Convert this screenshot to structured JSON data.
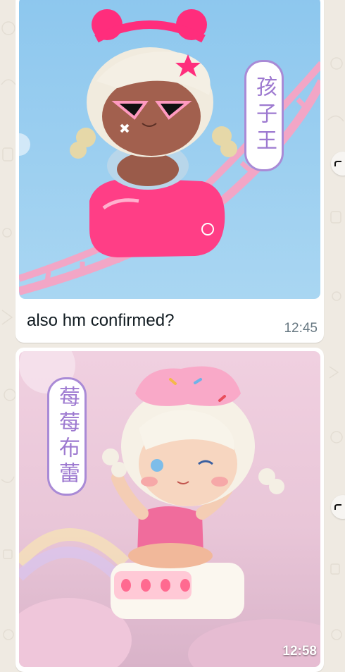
{
  "chat": {
    "messages": [
      {
        "type": "image",
        "image": {
          "label": "孩子王"
        },
        "caption": "also hm confirmed?",
        "time": "12:45",
        "forward_icon": "forward-icon"
      },
      {
        "type": "image",
        "image": {
          "label": "莓莓布蕾"
        },
        "time": "12:58",
        "forward_icon": "forward-icon"
      }
    ]
  },
  "colors": {
    "background": "#efeae2",
    "bubble": "#ffffff",
    "timestamp": "#667781",
    "text": "#111b21",
    "label_border": "#a98ad6",
    "label_text": "#9d79d0"
  }
}
